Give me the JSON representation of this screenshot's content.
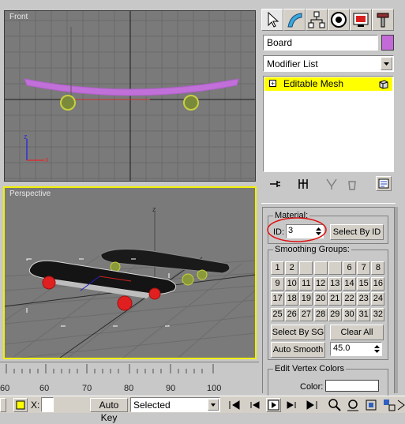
{
  "viewports": {
    "front_label": "Front",
    "perspective_label": "Perspective"
  },
  "command_panel": {
    "tabs": [
      "create-tab",
      "modify-tab",
      "hierarchy-tab",
      "motion-tab",
      "display-tab",
      "utilities-tab"
    ],
    "object_name": "Board",
    "object_color": "#c46ad8",
    "modifier_list_label": "Modifier List",
    "stack_item": "Editable Mesh",
    "stack_expand": "+"
  },
  "material": {
    "group_title": "Material:",
    "id_label": "ID:",
    "id_value": "3",
    "select_by_id": "Select By ID"
  },
  "smoothing": {
    "group_title": "Smoothing Groups:",
    "groups": [
      "1",
      "2",
      "",
      "",
      "",
      "6",
      "7",
      "8",
      "9",
      "10",
      "11",
      "12",
      "13",
      "14",
      "15",
      "16",
      "17",
      "18",
      "19",
      "20",
      "21",
      "22",
      "23",
      "24",
      "25",
      "26",
      "27",
      "28",
      "29",
      "30",
      "31",
      "32"
    ],
    "select_by_sg": "Select By SG",
    "clear_all": "Clear All",
    "auto_smooth": "Auto Smooth",
    "threshold": "45.0"
  },
  "vertex_colors": {
    "group_title": "Edit Vertex Colors",
    "color_label": "Color:"
  },
  "timeline": {
    "ticks": [
      "60",
      "60",
      "70",
      "80",
      "90",
      "100"
    ]
  },
  "bottom_bar": {
    "x_label": "X:",
    "auto_key": "Auto Key",
    "selection": "Selected"
  },
  "colors": {
    "viewport_bg": "#7a7a7a",
    "active_border": "#f0f000",
    "mesh_selected": "#ffff00"
  }
}
